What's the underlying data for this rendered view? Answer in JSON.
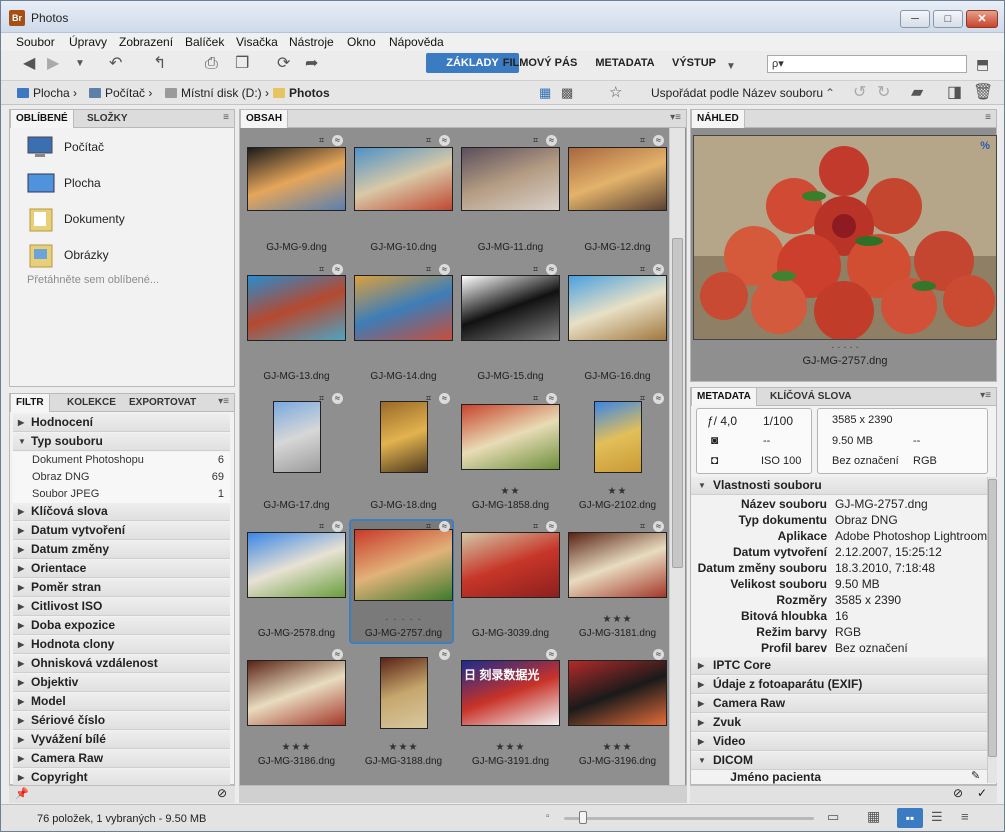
{
  "app": {
    "title": "Photos",
    "icon_text": "Br"
  },
  "window": {
    "min": "─",
    "max": "□",
    "close": "✕"
  },
  "menu": [
    "Soubor",
    "Úpravy",
    "Zobrazení",
    "Balíček",
    "Visačka",
    "Nástroje",
    "Okno",
    "Nápověda"
  ],
  "workspaces": {
    "basic": "ZÁKLADY",
    "filmstrip": "FILMOVÝ PÁS",
    "metadata": "METADATA",
    "output": "VÝSTUP"
  },
  "search": {
    "placeholder": "ρ▾"
  },
  "path": {
    "desktop": "Plocha",
    "computer": "Počítač",
    "disk": "Místní disk (D:)",
    "folder": "Photos"
  },
  "sort": {
    "label": "Uspořádat podle Název souboru"
  },
  "favorites": {
    "tabs": [
      "OBLÍBENÉ",
      "SLOŽKY"
    ],
    "items": [
      "Počítač",
      "Plocha",
      "Dokumenty",
      "Obrázky"
    ],
    "hint": "Přetáhněte sem oblíbené..."
  },
  "filter": {
    "tabs": [
      "FILTR",
      "KOLEKCE",
      "EXPORTOVAT"
    ],
    "sections": [
      "Hodnocení",
      "Typ souboru",
      "Klíčová slova",
      "Datum vytvoření",
      "Datum změny",
      "Orientace",
      "Poměr stran",
      "Citlivost ISO",
      "Doba expozice",
      "Hodnota clony",
      "Ohnisková vzdálenost",
      "Objektiv",
      "Model",
      "Sériové číslo",
      "Vyvážení bílé",
      "Camera Raw",
      "Copyright"
    ],
    "file_types": [
      {
        "name": "Dokument Photoshopu",
        "count": "6"
      },
      {
        "name": "Obraz DNG",
        "count": "69"
      },
      {
        "name": "Soubor JPEG",
        "count": "1"
      }
    ]
  },
  "content": {
    "tab": "OBSAH",
    "thumbnails": [
      {
        "name": "GJ-MG-9.dng",
        "stars": ""
      },
      {
        "name": "GJ-MG-10.dng",
        "stars": ""
      },
      {
        "name": "GJ-MG-11.dng",
        "stars": ""
      },
      {
        "name": "GJ-MG-12.dng",
        "stars": ""
      },
      {
        "name": "GJ-MG-13.dng",
        "stars": ""
      },
      {
        "name": "GJ-MG-14.dng",
        "stars": ""
      },
      {
        "name": "GJ-MG-15.dng",
        "stars": ""
      },
      {
        "name": "GJ-MG-16.dng",
        "stars": ""
      },
      {
        "name": "GJ-MG-17.dng",
        "stars": ""
      },
      {
        "name": "GJ-MG-18.dng",
        "stars": ""
      },
      {
        "name": "GJ-MG-1858.dng",
        "stars": "★★"
      },
      {
        "name": "GJ-MG-2102.dng",
        "stars": "★★"
      },
      {
        "name": "GJ-MG-2578.dng",
        "stars": ""
      },
      {
        "name": "GJ-MG-2757.dng",
        "stars": "· · · · ·"
      },
      {
        "name": "GJ-MG-3039.dng",
        "stars": ""
      },
      {
        "name": "GJ-MG-3181.dng",
        "stars": "★★★"
      },
      {
        "name": "GJ-MG-3186.dng",
        "stars": "★★★"
      },
      {
        "name": "GJ-MG-3188.dng",
        "stars": "★★★"
      },
      {
        "name": "GJ-MG-3191.dng",
        "stars": "★★★"
      },
      {
        "name": "GJ-MG-3196.dng",
        "stars": "★★★"
      }
    ],
    "partial_text": "日 刻录数据光"
  },
  "preview": {
    "tab": "NÁHLED",
    "filename": "GJ-MG-2757.dng",
    "rating": "· · · · ·",
    "sign": "%"
  },
  "metadata": {
    "tabs": [
      "METADATA",
      "KLÍČOVÁ SLOVA"
    ],
    "camera": {
      "aperture": "4,0",
      "shutter": "1/100",
      "metering": "--",
      "iso_label": "ISO",
      "iso": "100",
      "aperture_prefix": "ƒ/"
    },
    "summary": {
      "dimensions": "3585 x 2390",
      "size": "9.50 MB",
      "size_extra": "--",
      "profile": "Bez označení",
      "mode": "RGB"
    },
    "file_section": "Vlastnosti souboru",
    "fields": [
      {
        "k": "Název souboru",
        "v": "GJ-MG-2757.dng"
      },
      {
        "k": "Typ dokumentu",
        "v": "Obraz DNG"
      },
      {
        "k": "Aplikace",
        "v": "Adobe Photoshop Lightroom"
      },
      {
        "k": "Datum vytvoření",
        "v": "2.12.2007, 15:25:12"
      },
      {
        "k": "Datum změny souboru",
        "v": "18.3.2010, 7:18:48"
      },
      {
        "k": "Velikost souboru",
        "v": "9.50 MB"
      },
      {
        "k": "Rozměry",
        "v": "3585 x 2390"
      },
      {
        "k": "Bitová hloubka",
        "v": "16"
      },
      {
        "k": "Režim barvy",
        "v": "RGB"
      },
      {
        "k": "Profil barev",
        "v": "Bez označení"
      }
    ],
    "sections": [
      "IPTC Core",
      "Údaje z fotoaparátu (EXIF)",
      "Camera Raw",
      "Zvuk",
      "Video",
      "DICOM"
    ],
    "dicom_field": "Jméno pacienta"
  },
  "status": {
    "text": "76 položek, 1 vybraných - 9.50 MB"
  }
}
